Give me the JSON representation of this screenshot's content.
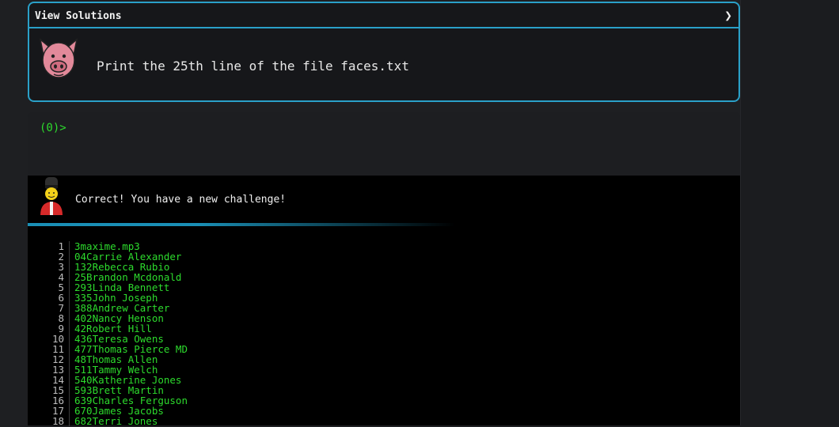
{
  "challenge": {
    "header": "View Solutions",
    "chevron": "❯",
    "icon": "pig-face-icon",
    "text": "Print the 25th line of the file faces.txt"
  },
  "terminal": {
    "prompt": "(0)>"
  },
  "result": {
    "icon": "royal-guard-icon",
    "message": "Correct! You have a new challenge!"
  },
  "lines": [
    {
      "n": "1",
      "text": "3maxime.mp3"
    },
    {
      "n": "2",
      "text": "04Carrie Alexander"
    },
    {
      "n": "3",
      "text": "132Rebecca Rubio"
    },
    {
      "n": "4",
      "text": "25Brandon Mcdonald"
    },
    {
      "n": "5",
      "text": "293Linda Bennett"
    },
    {
      "n": "6",
      "text": "335John Joseph"
    },
    {
      "n": "7",
      "text": "388Andrew Carter"
    },
    {
      "n": "8",
      "text": "402Nancy Henson"
    },
    {
      "n": "9",
      "text": "42Robert Hill"
    },
    {
      "n": "10",
      "text": "436Teresa Owens"
    },
    {
      "n": "11",
      "text": "477Thomas Pierce MD"
    },
    {
      "n": "12",
      "text": "48Thomas Allen"
    },
    {
      "n": "13",
      "text": "511Tammy Welch"
    },
    {
      "n": "14",
      "text": "540Katherine Jones"
    },
    {
      "n": "15",
      "text": "593Brett Martin"
    },
    {
      "n": "16",
      "text": "639Charles Ferguson"
    },
    {
      "n": "17",
      "text": "670James Jacobs"
    },
    {
      "n": "18",
      "text": "682Terri Jones"
    }
  ],
  "colors": {
    "accent": "#2aa0c8",
    "terminal_green": "#2ddb2d"
  }
}
